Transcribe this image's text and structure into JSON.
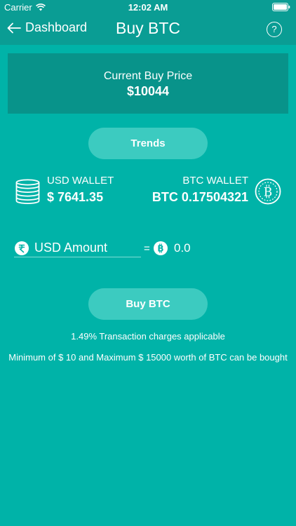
{
  "status_bar": {
    "carrier": "Carrier",
    "time": "12:02 AM",
    "icons": [
      "wifi-icon",
      "battery-icon"
    ]
  },
  "nav": {
    "back_label": "Dashboard",
    "title": "Buy BTC",
    "help_symbol": "?"
  },
  "price": {
    "caption": "Current Buy Price",
    "value": "$10044"
  },
  "trends_label": "Trends",
  "usd_wallet": {
    "label": "USD WALLET",
    "value": "$ 7641.35"
  },
  "btc_wallet": {
    "label": "BTC WALLET",
    "value": "BTC 0.17504321"
  },
  "amount": {
    "placeholder": "USD Amount",
    "equals": "=",
    "btc_value": "0.0"
  },
  "buy_label": "Buy BTC",
  "notes": {
    "charges": "1.49% Transaction charges applicable",
    "limits": "Minimum of $ 10 and Maximum $ 15000 worth of BTC can be bought"
  },
  "colors": {
    "background": "#00b3a8",
    "nav_background": "#0a9d94",
    "price_box": "#08938a",
    "button": "#3ccbc0"
  }
}
